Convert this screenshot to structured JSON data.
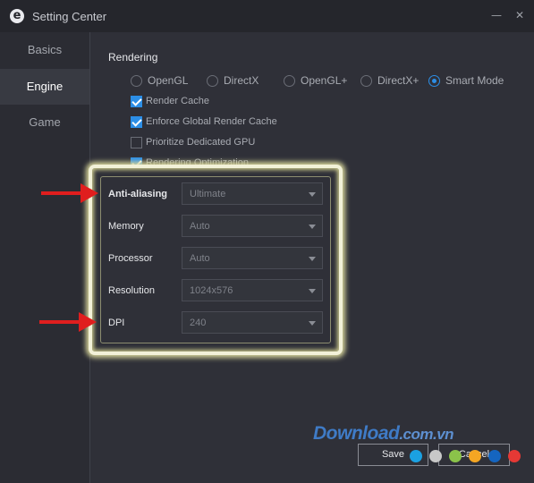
{
  "window": {
    "title": "Setting Center",
    "logo_glyph": "e",
    "minimize_glyph": "—",
    "close_glyph": "✕"
  },
  "sidebar": {
    "items": [
      {
        "label": "Basics"
      },
      {
        "label": "Engine"
      },
      {
        "label": "Game"
      }
    ],
    "active": "Engine"
  },
  "rendering": {
    "title": "Rendering",
    "modes": [
      {
        "label": "OpenGL"
      },
      {
        "label": "DirectX"
      },
      {
        "label": "OpenGL+"
      },
      {
        "label": "DirectX+"
      },
      {
        "label": "Smart Mode"
      }
    ],
    "selected_mode": "Smart Mode",
    "options": [
      {
        "label": "Render Cache",
        "checked": true
      },
      {
        "label": "Enforce Global Render Cache",
        "checked": true
      },
      {
        "label": "Prioritize Dedicated GPU",
        "checked": false
      },
      {
        "label": "Rendering Optimization",
        "checked": true
      }
    ]
  },
  "fields": [
    {
      "label": "Anti-aliasing",
      "value": "Ultimate"
    },
    {
      "label": "Memory",
      "value": "Auto"
    },
    {
      "label": "Processor",
      "value": "Auto"
    },
    {
      "label": "Resolution",
      "value": "1024x576"
    },
    {
      "label": "DPI",
      "value": "240"
    }
  ],
  "buttons": {
    "save": "Save",
    "cancel": "Cancel"
  },
  "watermark": {
    "main": "Download",
    "suffix": ".com.vn"
  },
  "colors": {
    "accent": "#2c8ee6",
    "annotation_arrow": "#e01e1e",
    "highlight": "#f2f1d8",
    "watermark": "#3f7bc6"
  },
  "watermark_dots": [
    "#1ba1e2",
    "#c8c8c8",
    "#8bc34a",
    "#f5a623",
    "#1565c0",
    "#e53935"
  ]
}
